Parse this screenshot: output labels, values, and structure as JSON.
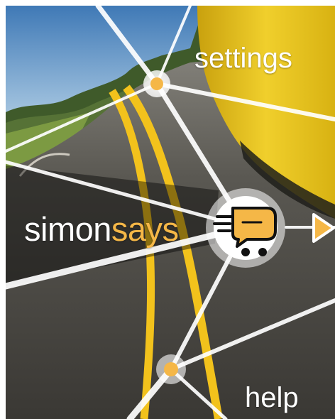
{
  "menu": {
    "settings_label": "settings",
    "help_label": "help"
  },
  "brand": {
    "part1": "simon",
    "part2": "says"
  },
  "icons": {
    "hub": "shopping-cart-chat-icon",
    "next": "play-arrow-icon",
    "node": "dot-icon"
  },
  "colors": {
    "accent": "#f5b747",
    "text": "#ffffff",
    "line": "#ffffff",
    "road_stripe": "#f2c21c",
    "car": "#e8c41a"
  }
}
